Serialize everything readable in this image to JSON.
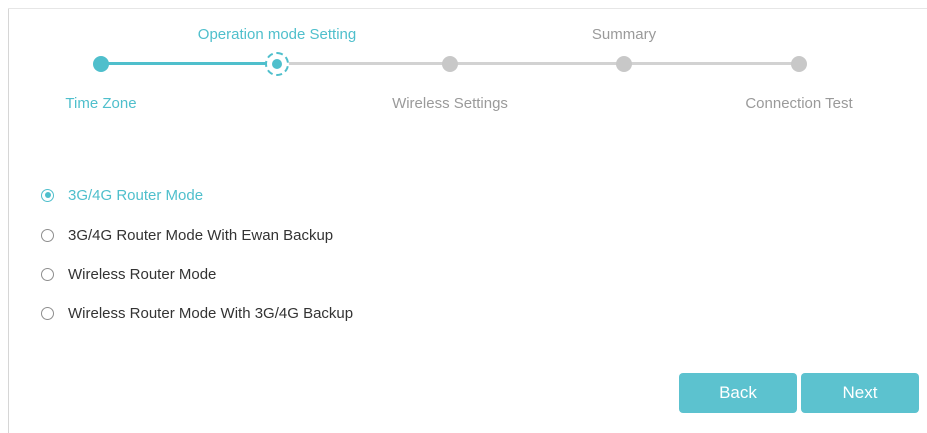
{
  "stepper": {
    "steps": [
      {
        "label": "Time Zone",
        "state": "done"
      },
      {
        "label": "Operation mode Setting",
        "state": "current"
      },
      {
        "label": "Wireless Settings",
        "state": "todo"
      },
      {
        "label": "Summary",
        "state": "todo"
      },
      {
        "label": "Connection Test",
        "state": "todo"
      }
    ]
  },
  "modes": {
    "options": [
      {
        "label": "3G/4G Router Mode",
        "checked": true
      },
      {
        "label": "3G/4G Router Mode With Ewan Backup",
        "checked": false
      },
      {
        "label": "Wireless Router Mode",
        "checked": false
      },
      {
        "label": "Wireless Router Mode With 3G/4G Backup",
        "checked": false
      }
    ]
  },
  "actions": {
    "back_label": "Back",
    "next_label": "Next"
  },
  "colors": {
    "accent": "#4fbfcc",
    "inactive_text": "#9a9a9a",
    "inactive_dot": "#c8c8c8",
    "button_bg": "#5cc2cf"
  }
}
